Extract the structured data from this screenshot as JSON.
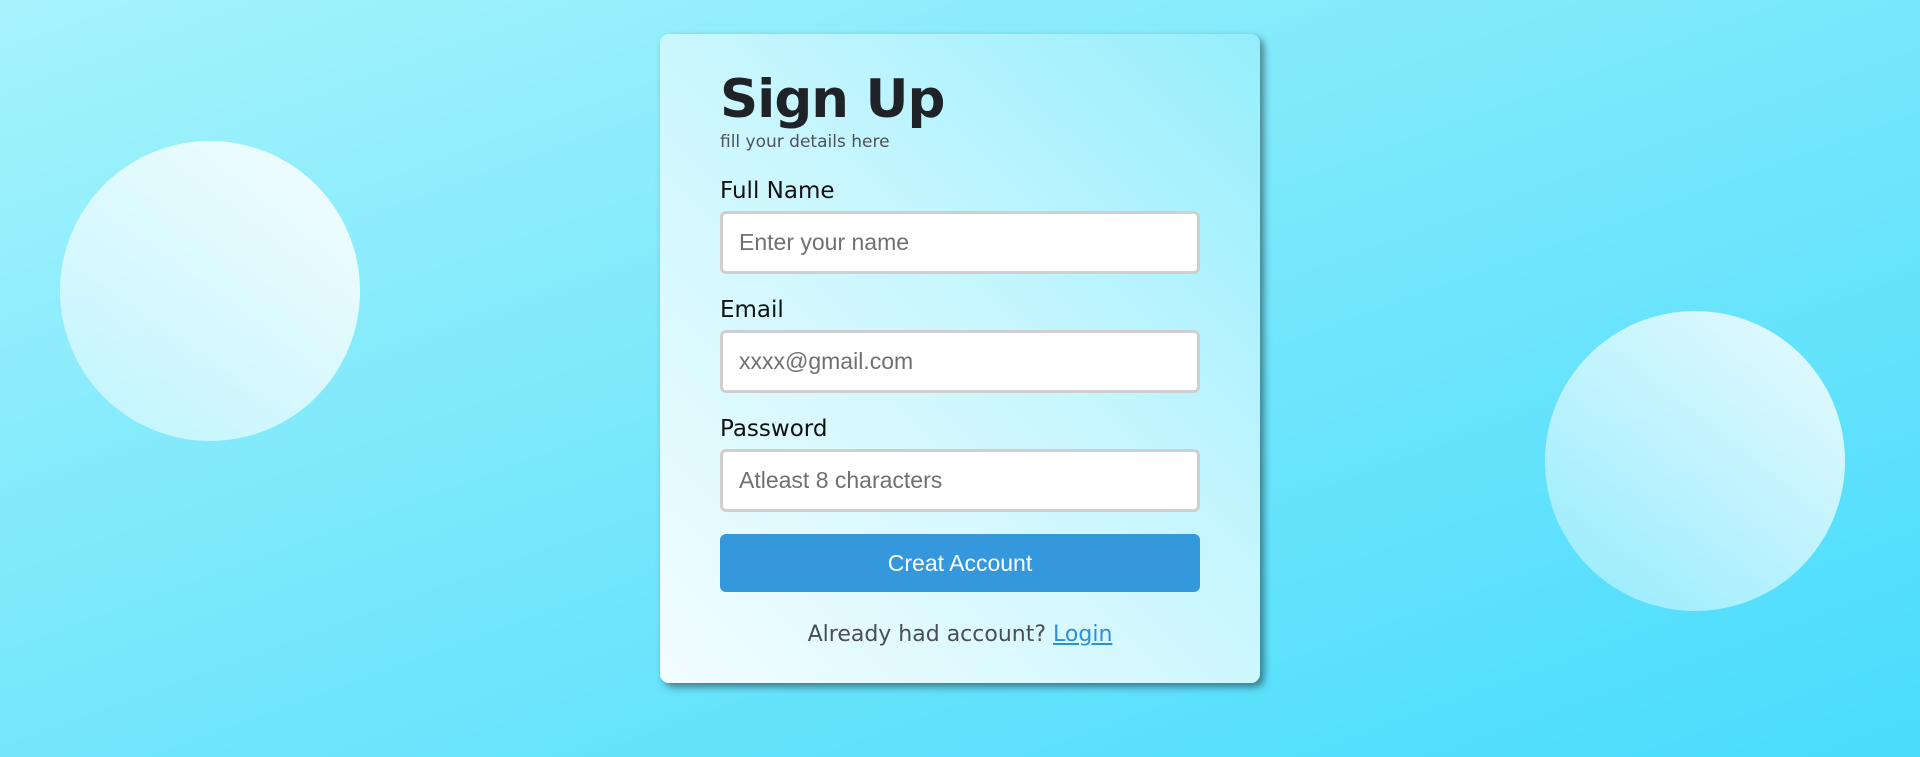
{
  "form": {
    "title": "Sign Up",
    "subtitle": "fill your details here",
    "fields": [
      {
        "label": "Full Name",
        "placeholder": "Enter your name",
        "value": ""
      },
      {
        "label": "Email",
        "placeholder": "xxxx@gmail.com",
        "value": ""
      },
      {
        "label": "Password",
        "placeholder": "Atleast 8 characters",
        "value": ""
      }
    ],
    "submit_label": "Creat Account",
    "footer_text": "Already had account?",
    "login_link": "Login"
  },
  "colors": {
    "button": "#3598dc",
    "link": "#2f8fd6",
    "background_start": "#a6f3fd",
    "background_end": "#48dcfd"
  }
}
